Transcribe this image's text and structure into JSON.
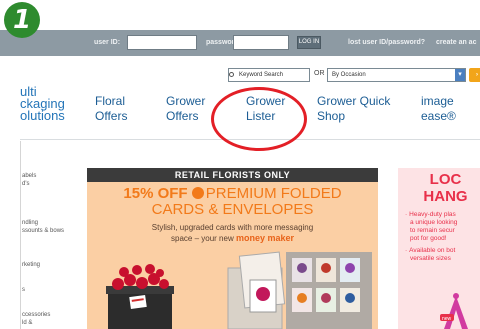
{
  "badge": {
    "step": "1"
  },
  "login": {
    "user_id_label": "user ID:",
    "password_label": "password:",
    "login_button": "LOG IN",
    "forgot_link": "lost user ID/password?",
    "create_link": "create an ac"
  },
  "search": {
    "keyword_placeholder": "Keyword Search",
    "or_label": "OR",
    "occasion_value": "By Occasion"
  },
  "logo": {
    "line1": "ulti",
    "line2": "ckaging",
    "line3": "olutions"
  },
  "nav": {
    "items": [
      {
        "line1": "Floral",
        "line2": "Offers"
      },
      {
        "line1": "Grower",
        "line2": "Offers"
      },
      {
        "line1": "Grower",
        "line2": "Lister"
      },
      {
        "line1": "Grower Quick",
        "line2": "Shop"
      },
      {
        "line1": "image",
        "line2": "ease®"
      }
    ]
  },
  "sidebar": {
    "items": [
      {
        "line1": "abels",
        "line2": "d's"
      },
      {
        "line1": "ndling",
        "line2": "ssounts & bows"
      },
      {
        "line1": "rketing",
        "line2": ""
      },
      {
        "line1": "s",
        "line2": ""
      },
      {
        "line1": "ccessories",
        "line2": "ld &"
      }
    ]
  },
  "promo": {
    "header": "RETAIL FLORISTS ONLY",
    "line1_a": "15% OFF",
    "line1_b": "PREMIUM FOLDED",
    "line2": "CARDS & ENVELOPES",
    "line3": "Stylish, upgraded cards with more messaging",
    "line4_a": "space – your new",
    "line4_b": "money maker"
  },
  "right_promo": {
    "title1": "LOC",
    "title2": "HANG",
    "bullets": [
      "Heavy-duty plas",
      "a unique looking",
      "to remain secur",
      "pot for good!",
      "Available on bot",
      "versatile sizes"
    ],
    "bullet_marks": [
      true,
      false,
      false,
      false,
      true,
      false
    ],
    "new_tag": "new"
  },
  "colors": {
    "login_bar": "#8d9aa3",
    "nav_text": "#1c5d94",
    "highlight_circle": "#e31f26",
    "promo_bg": "#fbcfa4",
    "promo_orange": "#f27a1a",
    "right_promo_red": "#e8304a",
    "badge_green": "#2e8b2e"
  }
}
